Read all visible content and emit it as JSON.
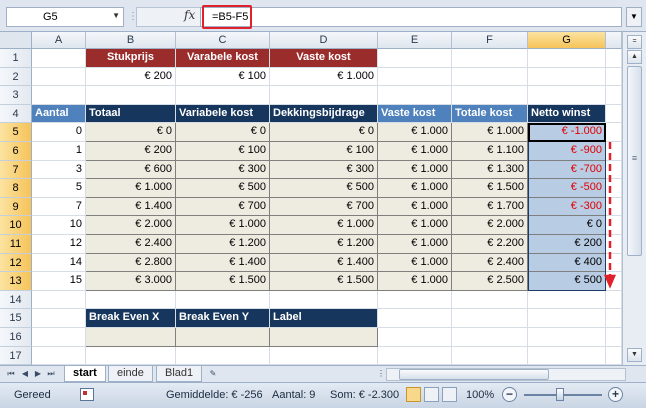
{
  "formula_bar": {
    "name_box": "G5",
    "fx": "fx",
    "formula": "=B5-F5"
  },
  "columns": [
    "A",
    "B",
    "C",
    "D",
    "E",
    "F",
    "G"
  ],
  "selected_column": "G",
  "rows": [
    "1",
    "2",
    "3",
    "4",
    "5",
    "6",
    "7",
    "8",
    "9",
    "10",
    "11",
    "12",
    "13",
    "14",
    "15",
    "16",
    "17"
  ],
  "input_table": {
    "headers": [
      "Stukprijs",
      "Varabele kost",
      "Vaste kost"
    ],
    "values": [
      "€ 200",
      "€ 100",
      "€ 1.000"
    ]
  },
  "main_table": {
    "headers": [
      "Aantal",
      "Totaal",
      "Variabele kost",
      "Dekkingsbijdrage",
      "Vaste kost",
      "Totale kost",
      "Netto winst"
    ],
    "rows": [
      [
        "0",
        "€ 0",
        "€ 0",
        "€ 0",
        "€ 1.000",
        "€ 1.000",
        "€ -1.000"
      ],
      [
        "1",
        "€ 200",
        "€ 100",
        "€ 100",
        "€ 1.000",
        "€ 1.100",
        "€ -900"
      ],
      [
        "3",
        "€ 600",
        "€ 300",
        "€ 300",
        "€ 1.000",
        "€ 1.300",
        "€ -700"
      ],
      [
        "5",
        "€ 1.000",
        "€ 500",
        "€ 500",
        "€ 1.000",
        "€ 1.500",
        "€ -500"
      ],
      [
        "7",
        "€ 1.400",
        "€ 700",
        "€ 700",
        "€ 1.000",
        "€ 1.700",
        "€ -300"
      ],
      [
        "10",
        "€ 2.000",
        "€ 1.000",
        "€ 1.000",
        "€ 1.000",
        "€ 2.000",
        "€ 0"
      ],
      [
        "12",
        "€ 2.400",
        "€ 1.200",
        "€ 1.200",
        "€ 1.000",
        "€ 2.200",
        "€ 200"
      ],
      [
        "14",
        "€ 2.800",
        "€ 1.400",
        "€ 1.400",
        "€ 1.000",
        "€ 2.400",
        "€ 400"
      ],
      [
        "15",
        "€ 3.000",
        "€ 1.500",
        "€ 1.500",
        "€ 1.000",
        "€ 2.500",
        "€ 500"
      ]
    ]
  },
  "break_even_table": {
    "headers": [
      "Break Even X",
      "Break Even Y",
      "Label"
    ]
  },
  "sheet_tabs": [
    "start",
    "einde",
    "Blad1"
  ],
  "active_sheet": "start",
  "status_bar": {
    "ready": "Gereed",
    "average": "Gemiddelde: € -256",
    "count": "Aantal: 9",
    "sum": "Som: € -2.300",
    "zoom": "100%",
    "zoom_minus": "−",
    "zoom_plus": "+"
  },
  "colors": {
    "header_red": "#9b2c2c",
    "header_navy": "#17365d",
    "header_blue": "#4f81bd",
    "cell_beige": "#eeece1",
    "netto_blue": "#b8cce4",
    "negative_red": "#e00000",
    "arrow_red": "#e0202a"
  }
}
